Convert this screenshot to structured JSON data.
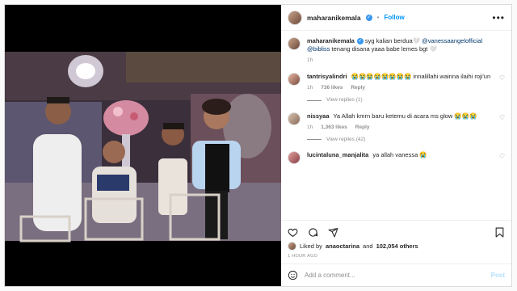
{
  "post": {
    "username": "maharanikemala",
    "follow_label": "Follow",
    "separator": "•",
    "more_label": "•••"
  },
  "caption": {
    "username": "maharanikemala",
    "text_a": "syg kalian berdua🤍 ",
    "mention_a": "@vanessaangelofficial",
    "mention_b": "@bibliss",
    "text_b": " tenang disana yaaa babe lemes bgt 🤍",
    "time": "1h"
  },
  "comments": [
    {
      "username": "tantrisyalindri",
      "text": "😭😭😭😭😭😭😭😭 innalillahi wainna ilaihi roji'un",
      "time": "1h",
      "likes": "736 likes",
      "reply": "Reply",
      "replies": "View replies (1)"
    },
    {
      "username": "nissyaa",
      "text": "Ya Allah kmrn baru ketemu di acara ms glow 😭😭😭",
      "time": "1h",
      "likes": "1,363 likes",
      "reply": "Reply",
      "replies": "View replies (42)"
    },
    {
      "username": "lucintaluna_manjalita",
      "text": "ya allah vanessa 😭",
      "time": "",
      "likes": "",
      "reply": "",
      "replies": ""
    }
  ],
  "likes": {
    "prefix": "Liked by",
    "user": "anaoctarina",
    "joiner": "and",
    "count": "102,054 others"
  },
  "timestamp": "1 HOUR AGO",
  "add_comment": {
    "placeholder": "Add a comment...",
    "post_label": "Post"
  },
  "icons": {
    "heart": "heart-icon",
    "comment": "comment-icon",
    "share": "share-icon",
    "save": "bookmark-icon",
    "emoji": "emoji-icon"
  },
  "colors": {
    "link": "#0095f6",
    "verified": "#3897f0",
    "muted": "#8e8e8e"
  }
}
